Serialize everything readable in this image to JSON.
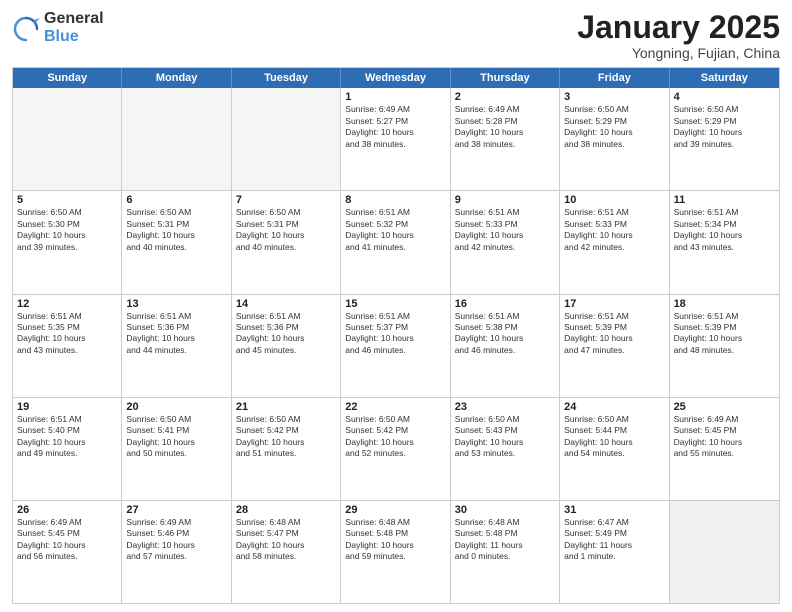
{
  "logo": {
    "general": "General",
    "blue": "Blue"
  },
  "title": "January 2025",
  "location": "Yongning, Fujian, China",
  "days": [
    "Sunday",
    "Monday",
    "Tuesday",
    "Wednesday",
    "Thursday",
    "Friday",
    "Saturday"
  ],
  "weeks": [
    [
      {
        "day": "",
        "content": ""
      },
      {
        "day": "",
        "content": ""
      },
      {
        "day": "",
        "content": ""
      },
      {
        "day": "1",
        "content": "Sunrise: 6:49 AM\nSunset: 5:27 PM\nDaylight: 10 hours\nand 38 minutes."
      },
      {
        "day": "2",
        "content": "Sunrise: 6:49 AM\nSunset: 5:28 PM\nDaylight: 10 hours\nand 38 minutes."
      },
      {
        "day": "3",
        "content": "Sunrise: 6:50 AM\nSunset: 5:29 PM\nDaylight: 10 hours\nand 38 minutes."
      },
      {
        "day": "4",
        "content": "Sunrise: 6:50 AM\nSunset: 5:29 PM\nDaylight: 10 hours\nand 39 minutes."
      }
    ],
    [
      {
        "day": "5",
        "content": "Sunrise: 6:50 AM\nSunset: 5:30 PM\nDaylight: 10 hours\nand 39 minutes."
      },
      {
        "day": "6",
        "content": "Sunrise: 6:50 AM\nSunset: 5:31 PM\nDaylight: 10 hours\nand 40 minutes."
      },
      {
        "day": "7",
        "content": "Sunrise: 6:50 AM\nSunset: 5:31 PM\nDaylight: 10 hours\nand 40 minutes."
      },
      {
        "day": "8",
        "content": "Sunrise: 6:51 AM\nSunset: 5:32 PM\nDaylight: 10 hours\nand 41 minutes."
      },
      {
        "day": "9",
        "content": "Sunrise: 6:51 AM\nSunset: 5:33 PM\nDaylight: 10 hours\nand 42 minutes."
      },
      {
        "day": "10",
        "content": "Sunrise: 6:51 AM\nSunset: 5:33 PM\nDaylight: 10 hours\nand 42 minutes."
      },
      {
        "day": "11",
        "content": "Sunrise: 6:51 AM\nSunset: 5:34 PM\nDaylight: 10 hours\nand 43 minutes."
      }
    ],
    [
      {
        "day": "12",
        "content": "Sunrise: 6:51 AM\nSunset: 5:35 PM\nDaylight: 10 hours\nand 43 minutes."
      },
      {
        "day": "13",
        "content": "Sunrise: 6:51 AM\nSunset: 5:36 PM\nDaylight: 10 hours\nand 44 minutes."
      },
      {
        "day": "14",
        "content": "Sunrise: 6:51 AM\nSunset: 5:36 PM\nDaylight: 10 hours\nand 45 minutes."
      },
      {
        "day": "15",
        "content": "Sunrise: 6:51 AM\nSunset: 5:37 PM\nDaylight: 10 hours\nand 46 minutes."
      },
      {
        "day": "16",
        "content": "Sunrise: 6:51 AM\nSunset: 5:38 PM\nDaylight: 10 hours\nand 46 minutes."
      },
      {
        "day": "17",
        "content": "Sunrise: 6:51 AM\nSunset: 5:39 PM\nDaylight: 10 hours\nand 47 minutes."
      },
      {
        "day": "18",
        "content": "Sunrise: 6:51 AM\nSunset: 5:39 PM\nDaylight: 10 hours\nand 48 minutes."
      }
    ],
    [
      {
        "day": "19",
        "content": "Sunrise: 6:51 AM\nSunset: 5:40 PM\nDaylight: 10 hours\nand 49 minutes."
      },
      {
        "day": "20",
        "content": "Sunrise: 6:50 AM\nSunset: 5:41 PM\nDaylight: 10 hours\nand 50 minutes."
      },
      {
        "day": "21",
        "content": "Sunrise: 6:50 AM\nSunset: 5:42 PM\nDaylight: 10 hours\nand 51 minutes."
      },
      {
        "day": "22",
        "content": "Sunrise: 6:50 AM\nSunset: 5:42 PM\nDaylight: 10 hours\nand 52 minutes."
      },
      {
        "day": "23",
        "content": "Sunrise: 6:50 AM\nSunset: 5:43 PM\nDaylight: 10 hours\nand 53 minutes."
      },
      {
        "day": "24",
        "content": "Sunrise: 6:50 AM\nSunset: 5:44 PM\nDaylight: 10 hours\nand 54 minutes."
      },
      {
        "day": "25",
        "content": "Sunrise: 6:49 AM\nSunset: 5:45 PM\nDaylight: 10 hours\nand 55 minutes."
      }
    ],
    [
      {
        "day": "26",
        "content": "Sunrise: 6:49 AM\nSunset: 5:45 PM\nDaylight: 10 hours\nand 56 minutes."
      },
      {
        "day": "27",
        "content": "Sunrise: 6:49 AM\nSunset: 5:46 PM\nDaylight: 10 hours\nand 57 minutes."
      },
      {
        "day": "28",
        "content": "Sunrise: 6:48 AM\nSunset: 5:47 PM\nDaylight: 10 hours\nand 58 minutes."
      },
      {
        "day": "29",
        "content": "Sunrise: 6:48 AM\nSunset: 5:48 PM\nDaylight: 10 hours\nand 59 minutes."
      },
      {
        "day": "30",
        "content": "Sunrise: 6:48 AM\nSunset: 5:48 PM\nDaylight: 11 hours\nand 0 minutes."
      },
      {
        "day": "31",
        "content": "Sunrise: 6:47 AM\nSunset: 5:49 PM\nDaylight: 11 hours\nand 1 minute."
      },
      {
        "day": "",
        "content": ""
      }
    ]
  ]
}
